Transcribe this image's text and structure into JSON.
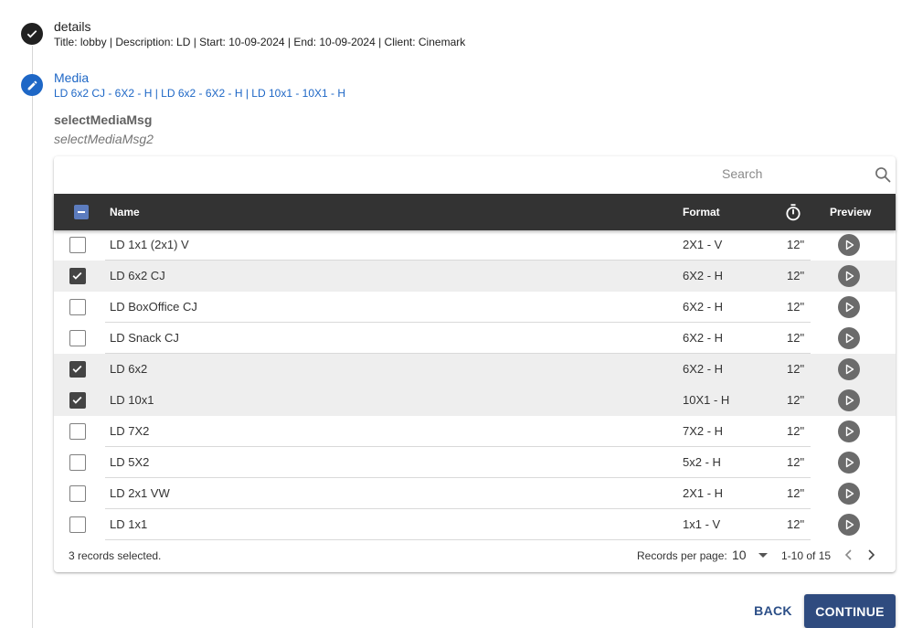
{
  "steps": [
    {
      "title": "details",
      "subtitle": "Title: lobby | Description: LD | Start: 10-09-2024 | End: 10-09-2024 | Client: Cinemark",
      "icon": "check-icon",
      "status": "completed"
    },
    {
      "title": "Media",
      "subtitle": "LD 6x2 CJ - 6X2 - H | LD 6x2 - 6X2 - H | LD 10x1 - 10X1 - H",
      "icon": "pencil-icon",
      "status": "active"
    }
  ],
  "messages": {
    "title": "selectMediaMsg",
    "subtitle": "selectMediaMsg2"
  },
  "search": {
    "placeholder": "Search",
    "value": "",
    "icon": "search-icon"
  },
  "table": {
    "columns": {
      "name": "Name",
      "format": "Format",
      "duration_icon": "timer-icon",
      "preview": "Preview"
    },
    "header_checkbox": "indeterminate",
    "rows": [
      {
        "name": "LD 1x1 (2x1) V",
        "format": "2X1 - V",
        "duration": "12\"",
        "selected": false
      },
      {
        "name": "LD 6x2 CJ",
        "format": "6X2 - H",
        "duration": "12\"",
        "selected": true
      },
      {
        "name": "LD BoxOffice CJ",
        "format": "6X2 - H",
        "duration": "12\"",
        "selected": false
      },
      {
        "name": "LD Snack CJ",
        "format": "6X2 - H",
        "duration": "12\"",
        "selected": false
      },
      {
        "name": "LD 6x2",
        "format": "6X2 - H",
        "duration": "12\"",
        "selected": true
      },
      {
        "name": "LD 10x1",
        "format": "10X1 - H",
        "duration": "12\"",
        "selected": true
      },
      {
        "name": "LD 7X2",
        "format": "7X2 - H",
        "duration": "12\"",
        "selected": false
      },
      {
        "name": "LD 5X2",
        "format": "5x2 - H",
        "duration": "12\"",
        "selected": false
      },
      {
        "name": "LD 2x1 VW",
        "format": "2X1 - H",
        "duration": "12\"",
        "selected": false
      },
      {
        "name": "LD 1x1",
        "format": "1x1 - V",
        "duration": "12\"",
        "selected": false
      }
    ]
  },
  "footer": {
    "selected_text": "3 records selected.",
    "rpp_label": "Records per page:",
    "rpp_value": "10",
    "range": "1-10 of 15"
  },
  "actions": {
    "back": "BACK",
    "continue": "CONTINUE"
  },
  "colors": {
    "accent": "#1e67c6",
    "header_bg": "#333333",
    "primary_button": "#2f4b7f"
  }
}
